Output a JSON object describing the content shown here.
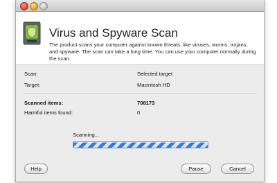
{
  "window": {
    "title": "Virus and Spyware Scan",
    "description": "The product scans your computer against known threats, like viruses, worms, trojans, and spyware. The scan can take a long time. You can use your computer normally during the scan."
  },
  "details": {
    "scan_label": "Scan:",
    "scan_value": "Selected target",
    "target_label": "Target:",
    "target_value": "Macintosh HD",
    "scanned_label": "Scanned items:",
    "scanned_value": "708173",
    "harmful_label": "Harmful items found:",
    "harmful_value": "0"
  },
  "status": {
    "text": "Scanning..."
  },
  "buttons": {
    "help": "Help",
    "pause": "Pause",
    "cancel": "Cancel"
  }
}
